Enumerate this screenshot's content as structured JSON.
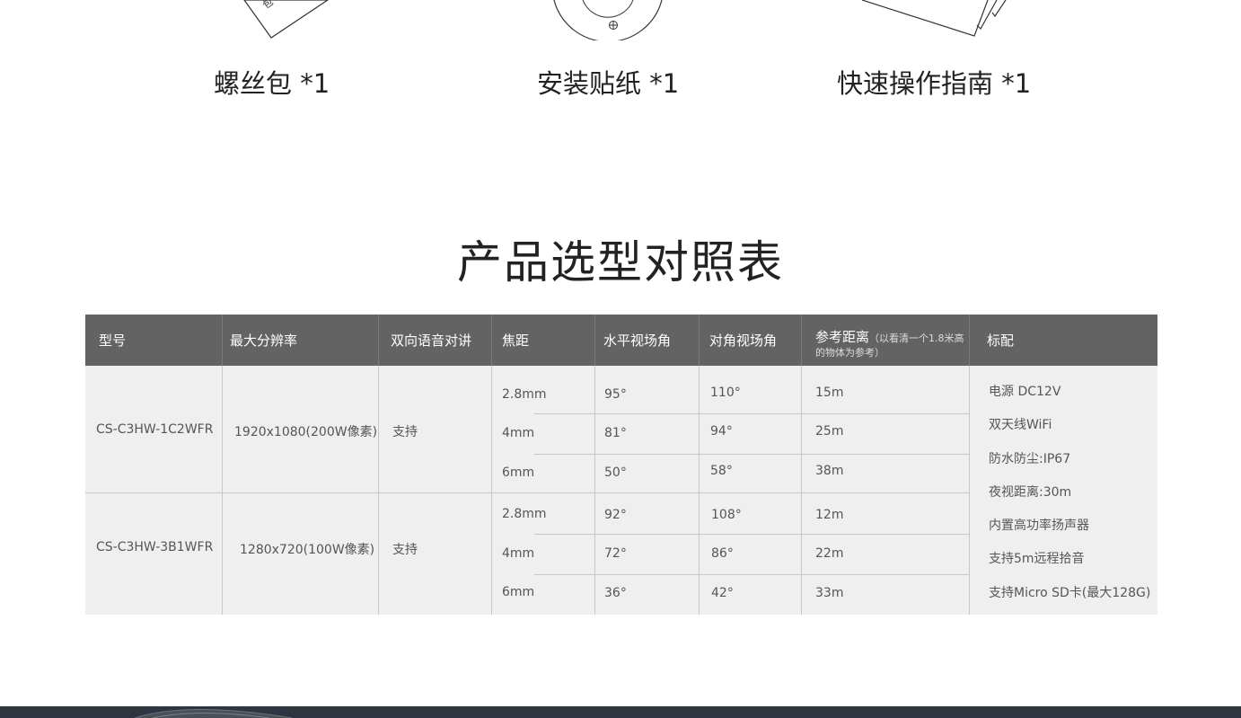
{
  "accessories": [
    {
      "label": "螺丝包 *1",
      "icon": "screw-pack-icon"
    },
    {
      "label": "安装贴纸 *1",
      "icon": "install-sticker-icon"
    },
    {
      "label": "快速操作指南 *1",
      "icon": "quick-guide-icon"
    }
  ],
  "section_title": "产品选型对照表",
  "table": {
    "headers": {
      "model": "型号",
      "resolution": "最大分辨率",
      "audio": "双向语音对讲",
      "focal": "焦距",
      "hfov": "水平视场角",
      "dfov": "对角视场角",
      "distance": "参考距离",
      "distance_note": "（以看清一个1.8米高的物体为参考）",
      "standard": "标配"
    },
    "rows": [
      {
        "model": "CS-C3HW-1C2WFR",
        "resolution": "1920x1080(200W像素)",
        "audio": "支持",
        "lenses": [
          {
            "focal": "2.8mm",
            "hfov": "95°",
            "dfov": "110°",
            "distance": "15m"
          },
          {
            "focal": "4mm",
            "hfov": "81°",
            "dfov": "94°",
            "distance": "25m"
          },
          {
            "focal": "6mm",
            "hfov": "50°",
            "dfov": "58°",
            "distance": "38m"
          }
        ]
      },
      {
        "model": "CS-C3HW-3B1WFR",
        "resolution": "1280x720(100W像素)",
        "audio": "支持",
        "lenses": [
          {
            "focal": "2.8mm",
            "hfov": "92°",
            "dfov": "108°",
            "distance": "12m"
          },
          {
            "focal": "4mm",
            "hfov": "72°",
            "dfov": "86°",
            "distance": "22m"
          },
          {
            "focal": "6mm",
            "hfov": "36°",
            "dfov": "42°",
            "distance": "33m"
          }
        ]
      }
    ],
    "standard_items": [
      "电源 DC12V",
      "双天线WiFi",
      "防水防尘:IP67",
      "夜视距离:30m",
      "内置高功率扬声器",
      "支持5m远程拾音",
      "支持Micro SD卡(最大128G)"
    ]
  },
  "colors": {
    "header_bg": "#636363",
    "table_bg": "#efefef",
    "footer_bg": "#2f3540"
  }
}
